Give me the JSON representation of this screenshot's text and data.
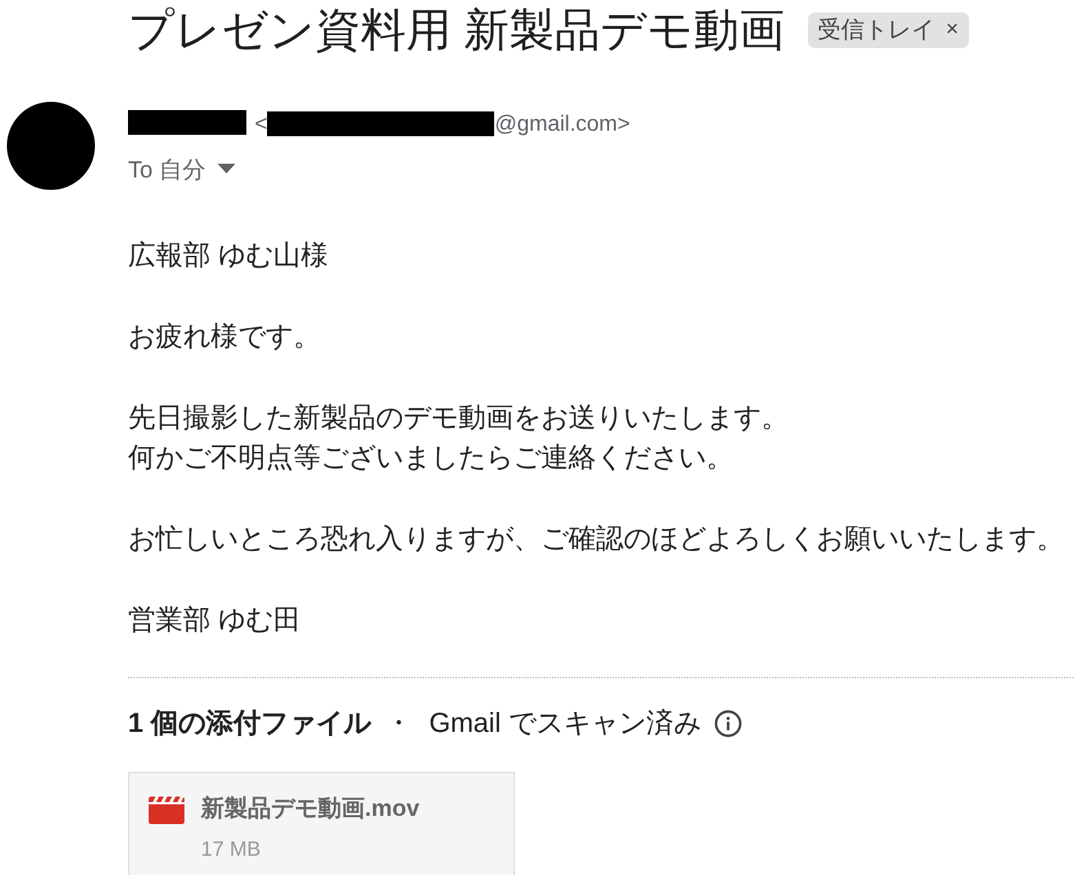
{
  "subject": "プレゼン資料用 新製品デモ動画",
  "labels": [
    {
      "text": "受信トレイ",
      "remove": "×"
    }
  ],
  "sender": {
    "name_redacted": true,
    "address_start": "<",
    "address_redacted": true,
    "address_end": "@gmail.com>"
  },
  "recipient": {
    "text": "To 自分"
  },
  "body": [
    [
      "広報部 ゆむ山様"
    ],
    [
      "お疲れ様です。"
    ],
    [
      "先日撮影した新製品のデモ動画をお送りいたします。",
      "何かご不明点等ございましたらご連絡ください。"
    ],
    [
      "お忙しいところ恐れ入りますが、ご確認のほどよろしくお願いいたします。"
    ],
    [
      "営業部 ゆむ田"
    ]
  ],
  "attachments": {
    "summary": "1 個の添付ファイル",
    "separator": "・",
    "scan_note": "Gmail でスキャン済み",
    "files": [
      {
        "kind": "video",
        "name": "新製品デモ動画.mov",
        "size": "17 MB"
      }
    ]
  }
}
